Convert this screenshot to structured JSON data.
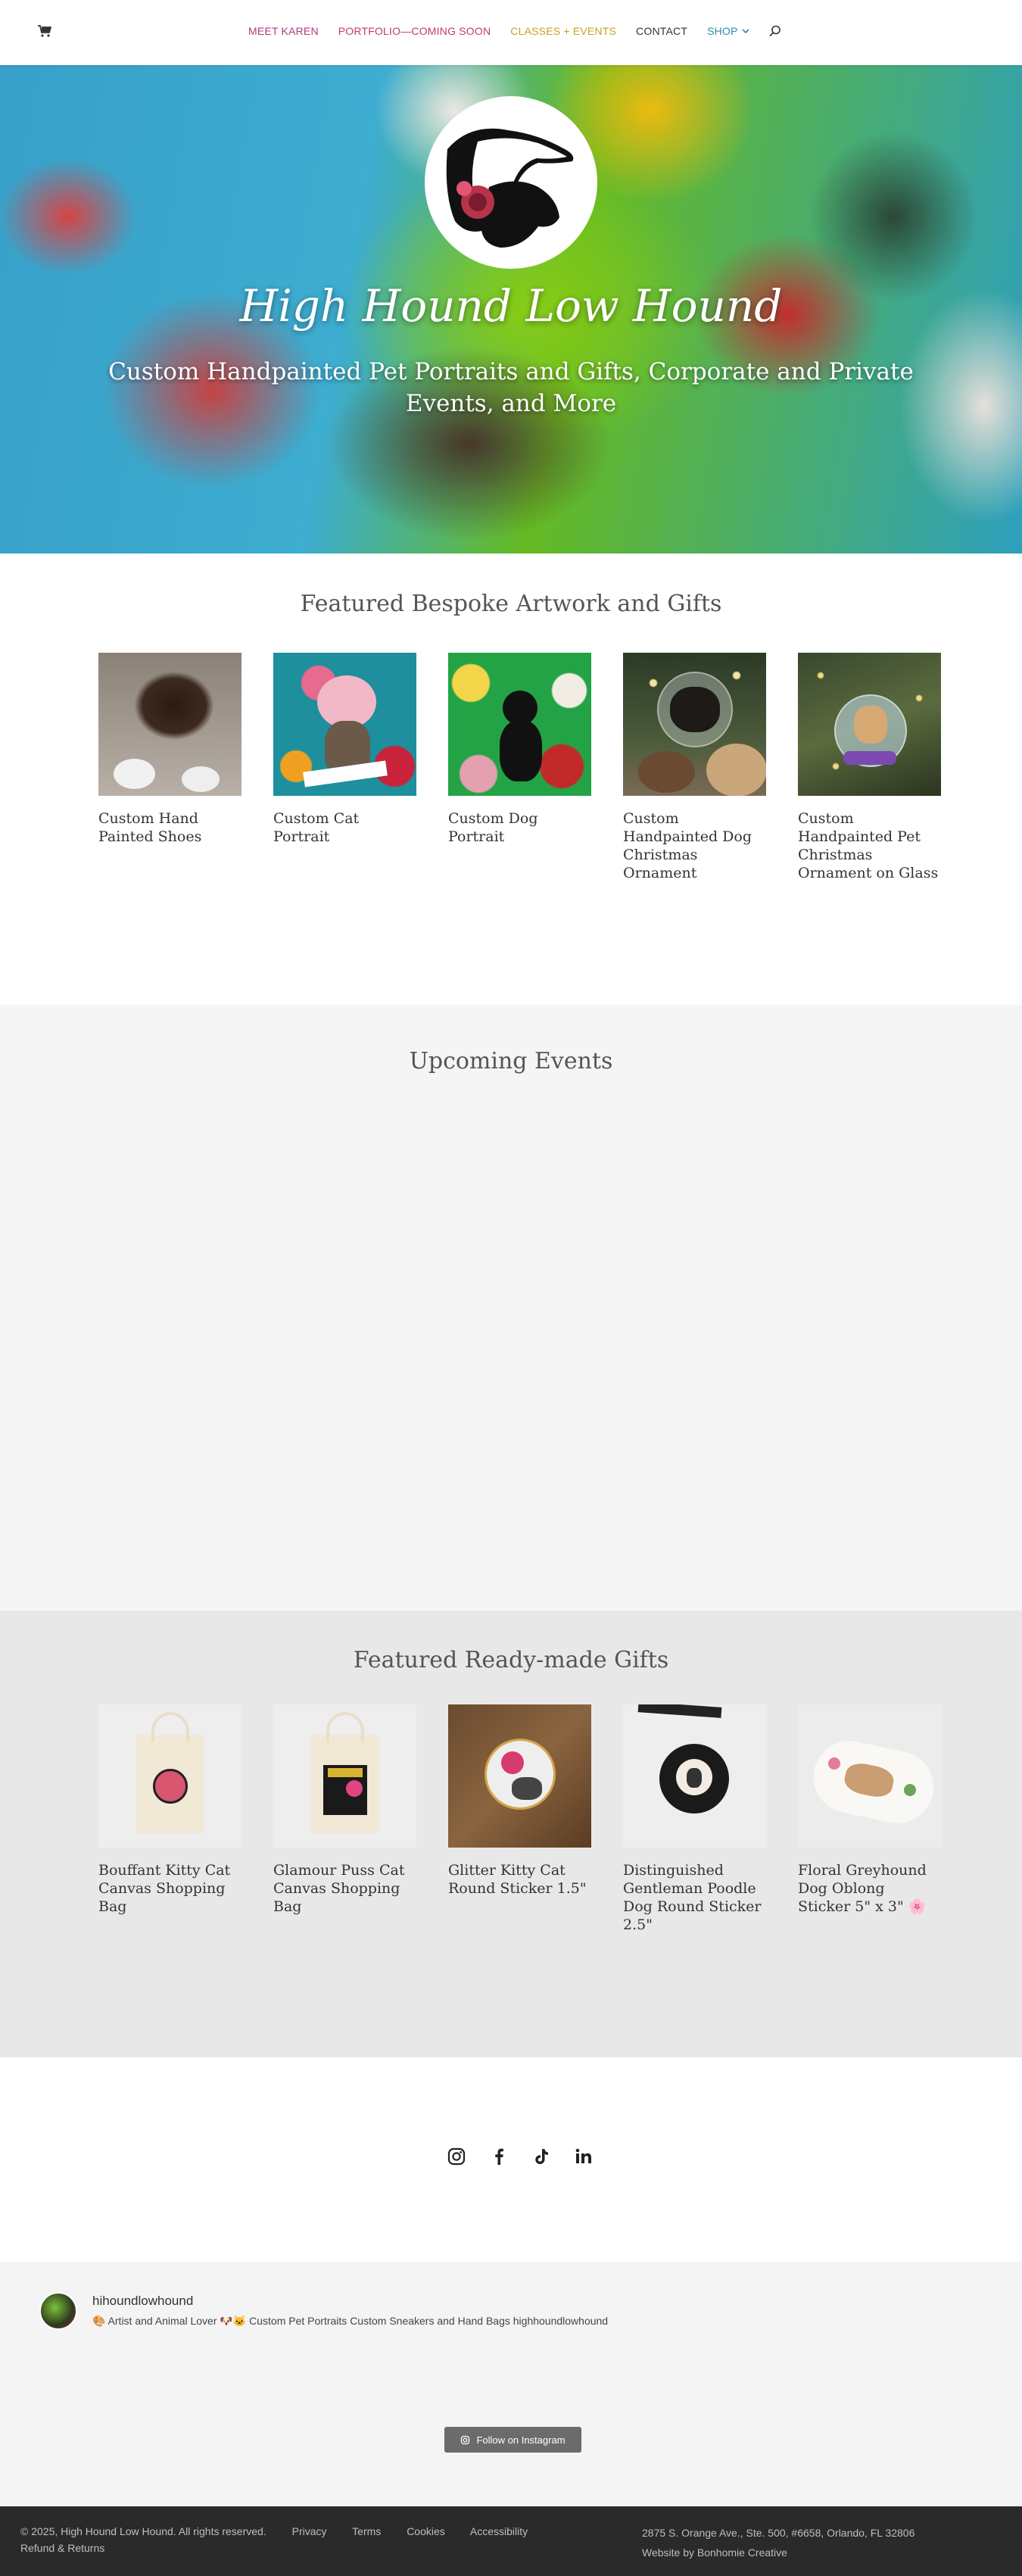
{
  "header": {
    "nav": [
      {
        "label": "MEET KAREN",
        "color": "#b03a7c"
      },
      {
        "label": "PORTFOLIO—COMING SOON",
        "color": "#c23b6a"
      },
      {
        "label": "CLASSES + EVENTS",
        "color": "#c6a21f"
      },
      {
        "label": "CONTACT",
        "color": "#333333"
      },
      {
        "label": "SHOP",
        "color": "#2a8fa8"
      }
    ],
    "icons": {
      "cart": "cart-icon",
      "search": "search-icon",
      "dropdown": "chevron-down-icon"
    }
  },
  "hero": {
    "brand": "High Hound Low Hound",
    "tagline": "Custom Handpainted Pet Portraits and Gifts, Corporate and Private Events, and More"
  },
  "featured": {
    "title": "Featured Bespoke Artwork and Gifts",
    "items": [
      {
        "title": "Custom Hand Painted Shoes"
      },
      {
        "title": "Custom Cat Portrait"
      },
      {
        "title": "Custom Dog Portrait"
      },
      {
        "title": "Custom Handpainted Dog Christmas Ornament"
      },
      {
        "title": "Custom Handpainted Pet Christmas Ornament on Glass"
      }
    ]
  },
  "events": {
    "title": "Upcoming Events"
  },
  "ready": {
    "title": "Featured Ready-made Gifts",
    "items": [
      {
        "title": "Bouffant Kitty Cat Canvas Shopping Bag"
      },
      {
        "title": "Glamour Puss Cat Canvas Shopping Bag"
      },
      {
        "title": "Glitter Kitty Cat Round Sticker 1.5\""
      },
      {
        "title": "Distinguished Gentleman Poodle Dog Round Sticker 2.5\""
      },
      {
        "title": "Floral Greyhound Dog Oblong Sticker 5\" x 3\" 🌸"
      }
    ]
  },
  "social_icons": [
    "instagram-icon",
    "facebook-icon",
    "tiktok-icon",
    "linkedin-icon"
  ],
  "instagram": {
    "handle": "hihoundlowhound",
    "bio": "🎨 Artist and Animal Lover 🐶🐱 Custom Pet Portraits Custom Sneakers and Hand Bags highhoundlowhound",
    "follow_label": "Follow on Instagram"
  },
  "footer": {
    "copyright": "© 2025, High Hound Low Hound. All rights reserved.",
    "links": [
      "Privacy",
      "Terms",
      "Cookies",
      "Accessibility",
      "Refund & Returns"
    ],
    "address": "2875 S. Orange Ave., Ste. 500, #6658, Orlando, FL 32806",
    "credit": "Website by Bonhomie Creative"
  }
}
